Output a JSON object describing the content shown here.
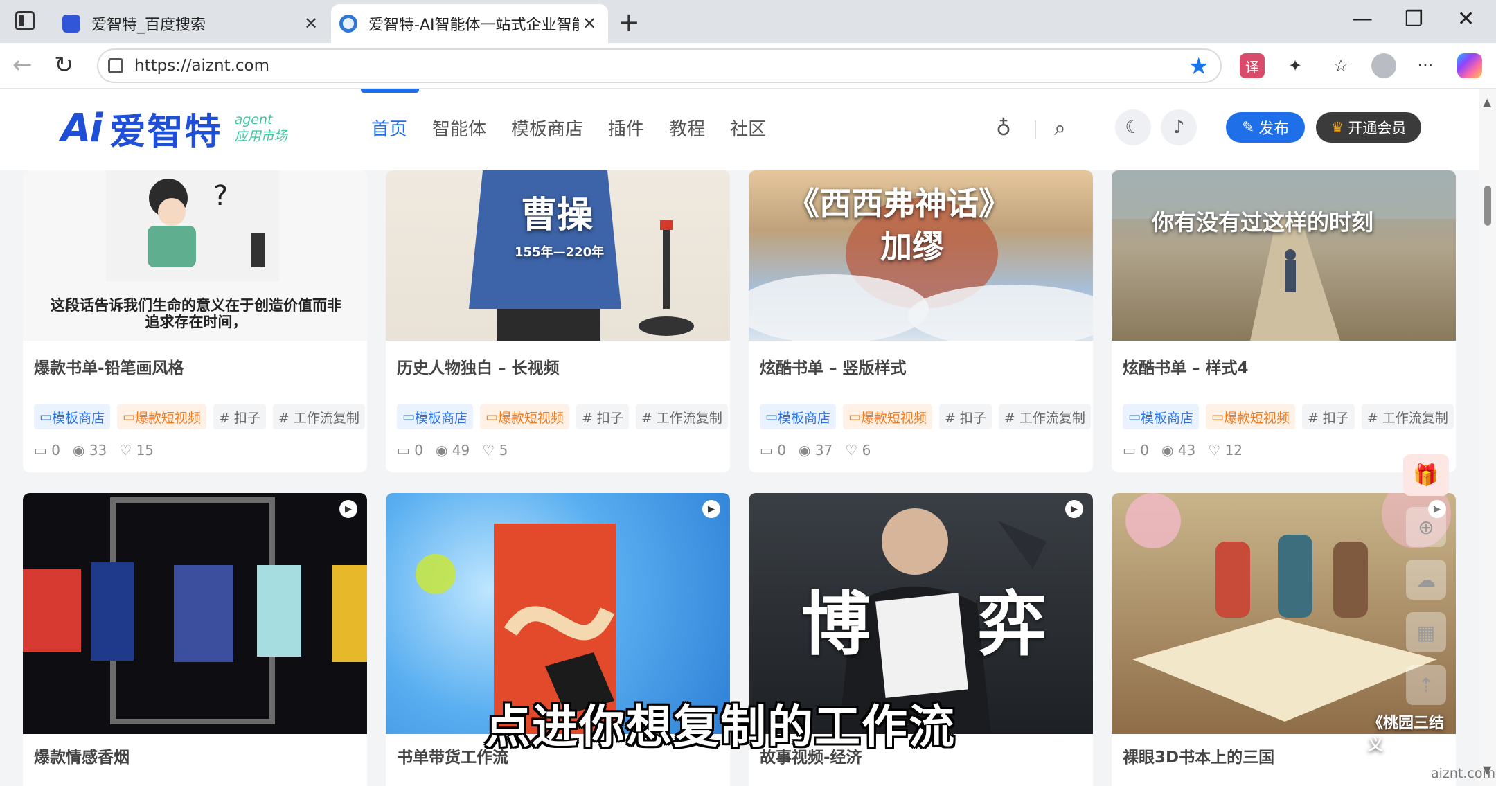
{
  "browser": {
    "tabs": [
      {
        "title": "爱智特_百度搜索",
        "close": "✕"
      },
      {
        "title": "爱智特-AI智能体一站式企业智能化",
        "close": "✕"
      }
    ],
    "new_tab": "+",
    "window_controls": {
      "minimize": "—",
      "restore": "❐",
      "close": "✕"
    },
    "url": "https://aiznt.com",
    "nav": {
      "back": "←",
      "reload": "↻",
      "bookmark_star": "★"
    }
  },
  "site": {
    "logo": {
      "ai": "Ai",
      "brand": "爱智特",
      "sub_line1": "agent",
      "sub_line2": "应用市场"
    },
    "nav": [
      "首页",
      "智能体",
      "模板商店",
      "插件",
      "教程",
      "社区"
    ],
    "active_nav": "首页",
    "publish_label": "发布",
    "vip_label": "开通会员"
  },
  "cards_row1": [
    {
      "title": "爆款书单-铅笔画风格",
      "tags": [
        "模板商店",
        "爆款短视频",
        "# 扣子",
        "# 工作流复制"
      ],
      "comments": "0",
      "views": "33",
      "likes": "15",
      "thumb_caption": "这段话告诉我们生命的意义在于创造价值而非追求存在时间，"
    },
    {
      "title": "历史人物独白 – 长视频",
      "tags": [
        "模板商店",
        "爆款短视频",
        "# 扣子",
        "# 工作流复制"
      ],
      "comments": "0",
      "views": "49",
      "likes": "5",
      "thumb_caption": "曹操",
      "thumb_sub": "155年—220年"
    },
    {
      "title": "炫酷书单 – 竖版样式",
      "tags": [
        "模板商店",
        "爆款短视频",
        "# 扣子",
        "# 工作流复制"
      ],
      "comments": "0",
      "views": "37",
      "likes": "6",
      "thumb_caption": "《西西弗神话》",
      "thumb_sub": "加缪"
    },
    {
      "title": "炫酷书单 – 样式4",
      "tags": [
        "模板商店",
        "爆款短视频",
        "# 扣子",
        "# 工作流复制"
      ],
      "comments": "0",
      "views": "43",
      "likes": "12",
      "thumb_caption": "你有没有过这样的时刻"
    }
  ],
  "cards_row2": [
    {
      "title": "爆款情感香烟"
    },
    {
      "title": "书单带货工作流"
    },
    {
      "title": "故事视频-经济",
      "thumb_caption_left": "博",
      "thumb_caption_right": "弈"
    },
    {
      "title": "裸眼3D书本上的三国",
      "thumb_caption": "《桃园三结义"
    }
  ],
  "subtitle": "点进你想复制的工作流",
  "watermark": "aiznt.com"
}
